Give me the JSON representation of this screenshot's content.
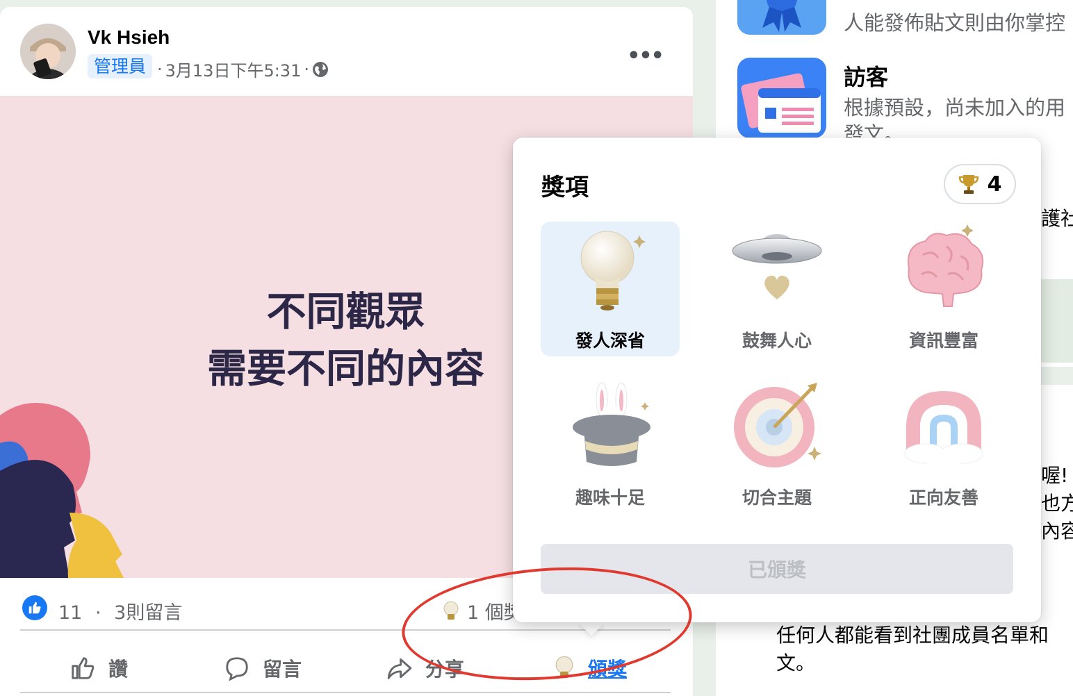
{
  "post": {
    "author": "Vk Hsieh",
    "role": "管理員",
    "timestamp": "3月13日下午5:31",
    "separator": "·",
    "more": "•••",
    "headline_line1": "不同觀眾",
    "headline_line2": "需要不同的內容",
    "like_count": "11",
    "comment_count": "3則留言",
    "award_summary": "1 個獎",
    "actions": {
      "like": "讚",
      "comment": "留言",
      "share": "分享",
      "award": "頒獎"
    }
  },
  "right_panel": {
    "top_fragment": "人能發佈貼文則由你掌控",
    "visitors_title": "訪客",
    "visitors_line1": "根據預設，尚未加入的用",
    "visitors_line2": "發文。",
    "frag_a": "護社",
    "frag_b": "喔!",
    "frag_c": "也方",
    "frag_d": "內容",
    "bottom_line1": "任何人都能看到社團成員名單和",
    "bottom_line2": "文。"
  },
  "awards_popup": {
    "title": "獎項",
    "trophy_count": "4",
    "items": [
      {
        "label": "發人深省",
        "icon": "lightbulb-icon"
      },
      {
        "label": "鼓舞人心",
        "icon": "ufo-heart-icon"
      },
      {
        "label": "資訊豐富",
        "icon": "brain-icon"
      },
      {
        "label": "趣味十足",
        "icon": "magic-hat-rabbit-icon"
      },
      {
        "label": "切合主題",
        "icon": "target-arrow-icon"
      },
      {
        "label": "正向友善",
        "icon": "rainbow-icon"
      }
    ],
    "awarded_button": "已頒獎"
  },
  "colors": {
    "accent": "#1877f2",
    "annotation": "#e03a30",
    "image_bg": "#f5dfe3"
  }
}
